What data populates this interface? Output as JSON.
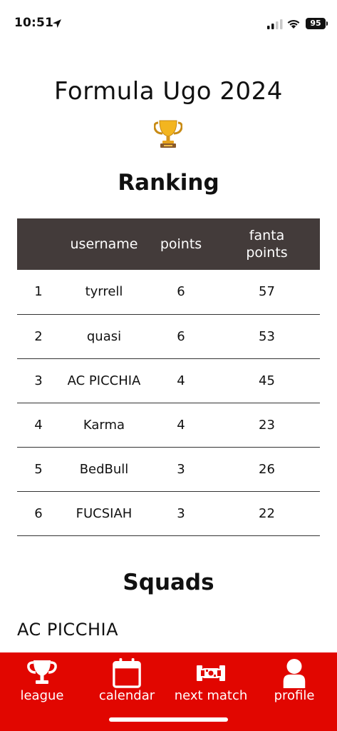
{
  "status_bar": {
    "time": "10:51",
    "battery": "95"
  },
  "page": {
    "title": "Formula Ugo 2024",
    "trophy_icon": "trophy-emoji"
  },
  "ranking": {
    "title": "Ranking",
    "headers": {
      "position": "",
      "username": "username",
      "points": "points",
      "fanta_points": "fanta points"
    },
    "rows": [
      {
        "position": "1",
        "username": "tyrrell",
        "points": "6",
        "fanta_points": "57"
      },
      {
        "position": "2",
        "username": "quasi",
        "points": "6",
        "fanta_points": "53"
      },
      {
        "position": "3",
        "username": "AC PICCHIA",
        "points": "4",
        "fanta_points": "45"
      },
      {
        "position": "4",
        "username": "Karma",
        "points": "4",
        "fanta_points": "23"
      },
      {
        "position": "5",
        "username": "BedBull",
        "points": "3",
        "fanta_points": "26"
      },
      {
        "position": "6",
        "username": "FUCSIAH",
        "points": "3",
        "fanta_points": "22"
      }
    ]
  },
  "squads": {
    "title": "Squads",
    "first_squad": "AC PICCHIA"
  },
  "bottom_nav": {
    "items": [
      {
        "label": "league",
        "icon": "trophy-icon"
      },
      {
        "label": "calendar",
        "icon": "calendar-icon"
      },
      {
        "label": "next match",
        "icon": "race-car-icon"
      },
      {
        "label": "profile",
        "icon": "user-icon"
      }
    ]
  },
  "colors": {
    "nav_background": "#e10600",
    "table_header": "#433b3a"
  }
}
